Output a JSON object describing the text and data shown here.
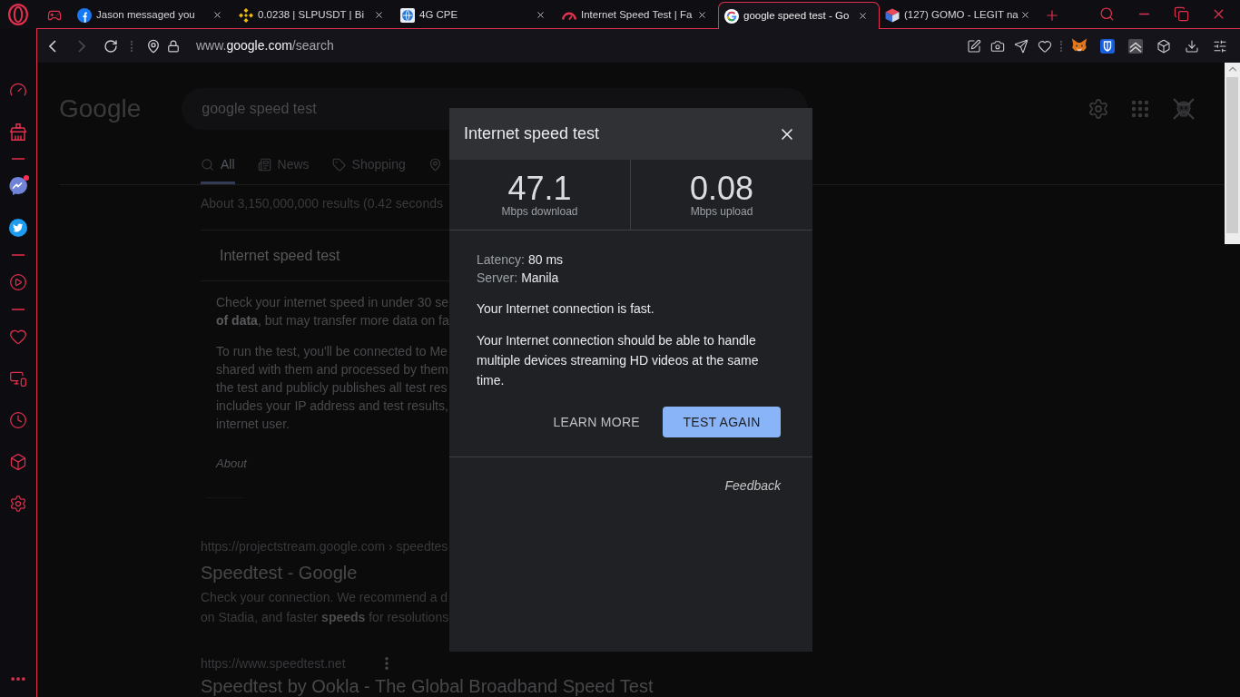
{
  "browser": {
    "tabs": [
      {
        "title": "Jason messaged you",
        "selected": false
      },
      {
        "title": "0.0238 | SLPUSDT | Bi",
        "selected": false
      },
      {
        "title": "4G CPE",
        "selected": false
      },
      {
        "title": "Internet Speed Test | Fa",
        "selected": false
      },
      {
        "title": "google speed test - Go",
        "selected": true
      },
      {
        "title": "(127) GOMO - LEGIT na",
        "selected": false
      }
    ],
    "navigation": {
      "back_disabled": false,
      "forward_disabled": true
    },
    "address_bar": {
      "url": "www.**google.com**/search"
    }
  },
  "sidebar": {
    "chat_unread": true
  },
  "google": {
    "logo": "Google",
    "query": "google speed test",
    "tabs": [
      {
        "label": "All",
        "selected": true
      },
      {
        "label": "News",
        "selected": false
      },
      {
        "label": "Shopping",
        "selected": false
      },
      {
        "selected": false
      }
    ],
    "result_stats": "About 3,150,000,000 results (0.42 seconds",
    "speed_card": {
      "title": "Internet speed test",
      "paragraphs": [
        [
          "Check your internet speed in under 30 se",
          "**of data**, but may transfer more data on fa"
        ],
        [
          "To run the test, you'll be connected to Me",
          "shared with them and processed by them",
          "the test and publicly publishes all test res",
          "includes your IP address and test results,",
          "internet user."
        ]
      ],
      "about": "About"
    },
    "results": [
      {
        "url": "https://projectstream.google.com › speedtes",
        "menu": false,
        "title": "Speedtest - Google",
        "snippet": [
          "Check your connection. We recommend a d",
          "on Stadia, and faster **speeds** for resolutions"
        ]
      },
      {
        "url": "https://www.speedtest.net",
        "menu": true,
        "title": "Speedtest by Ookla - The Global Broadband Speed Test"
      }
    ]
  },
  "speed_test_dialog": {
    "title": "Internet speed test",
    "stats": [
      {
        "value": "47.1",
        "unit": "Mbps download"
      },
      {
        "value": "0.08",
        "unit": "Mbps upload"
      }
    ],
    "details": [
      {
        "label": "Latency:",
        "value": "80 ms"
      },
      {
        "label": "Server:",
        "value": "Manila"
      }
    ],
    "verdict": "Your Internet connection is fast.",
    "description": "Your Internet connection should be able to handle multiple devices streaming HD videos at the same time.",
    "buttons": [
      {
        "label": "LEARN MORE",
        "kind": "text"
      },
      {
        "label": "TEST AGAIN",
        "kind": "filled"
      }
    ],
    "feedback": "Feedback"
  }
}
